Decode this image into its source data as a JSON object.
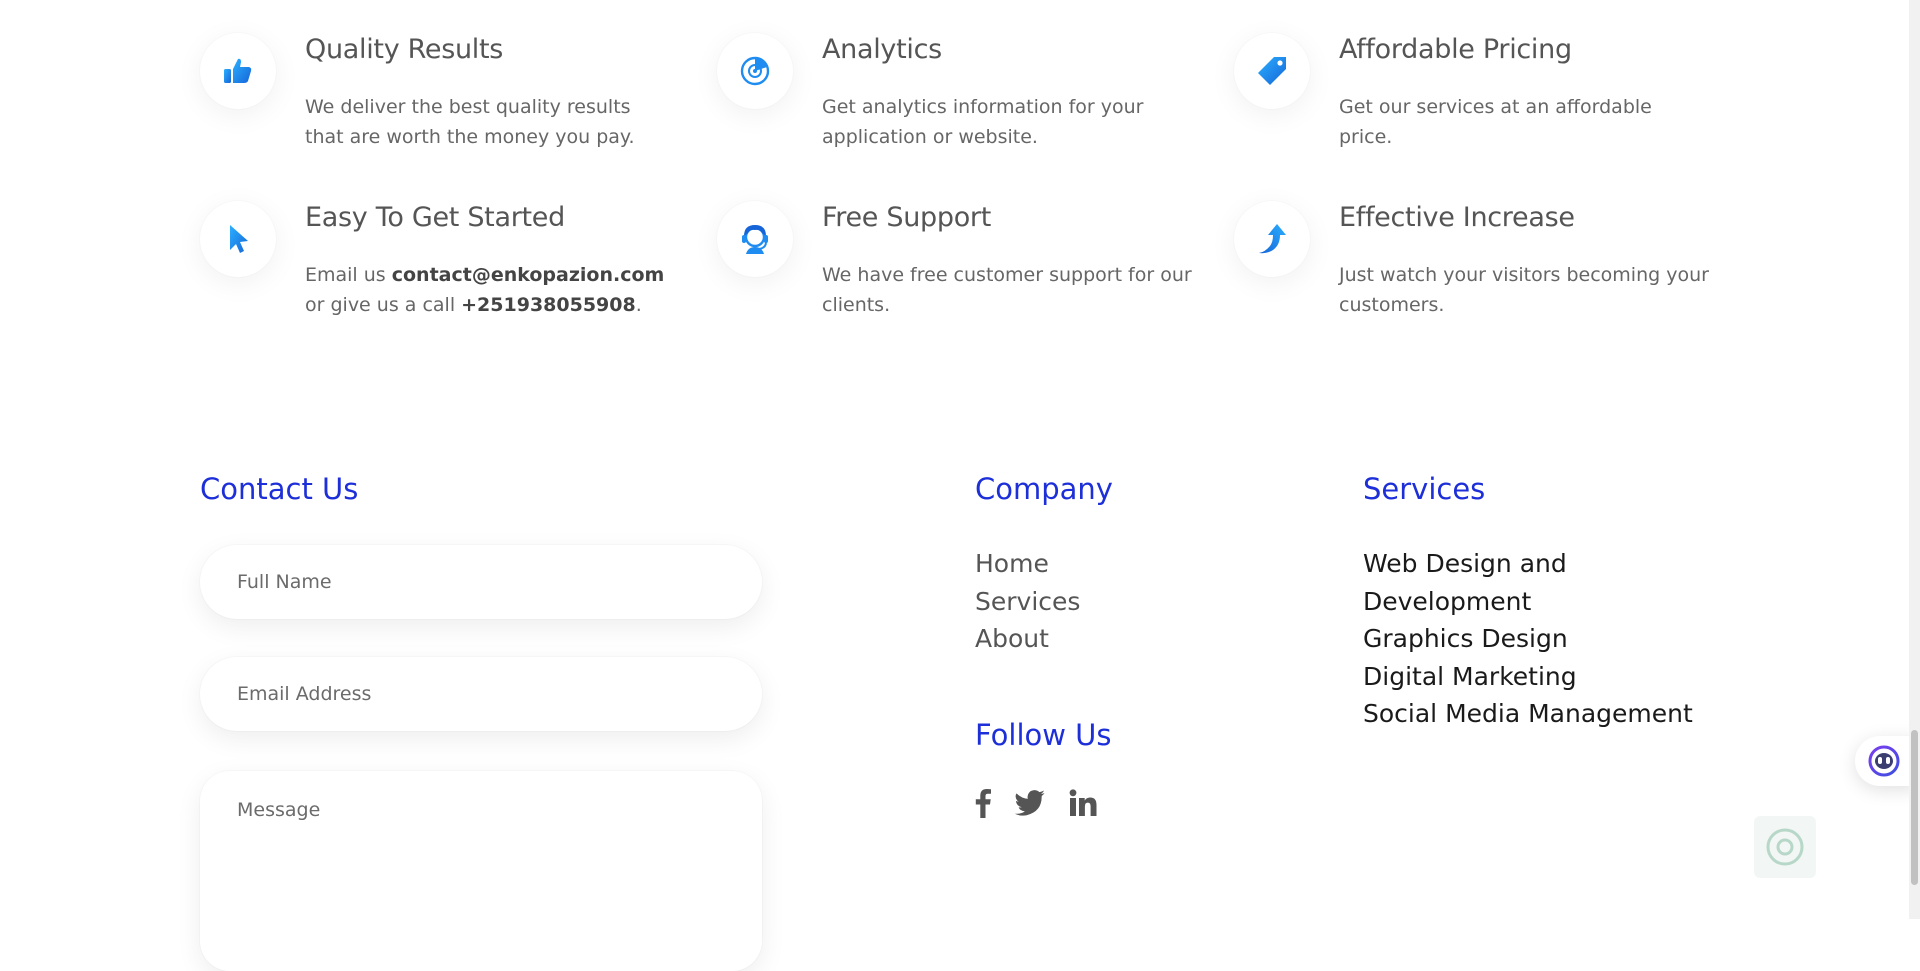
{
  "features": [
    {
      "icon": "thumbs-up-icon",
      "title": "Quality Results",
      "desc": "We deliver the best quality results that are worth the money you pay."
    },
    {
      "icon": "analytics-icon",
      "title": "Analytics",
      "desc": "Get analytics information for your application or website."
    },
    {
      "icon": "price-tag-icon",
      "title": "Affordable Pricing",
      "desc": "Get our services at an affordable price."
    },
    {
      "icon": "cursor-icon",
      "title": "Easy To Get Started",
      "desc_prefix": "Email us ",
      "email": "contact@enkopazion.com",
      "desc_middle": " or give us a call ",
      "phone": "+251938055908",
      "desc_suffix": "."
    },
    {
      "icon": "headset-support-icon",
      "title": "Free Support",
      "desc": "We have free customer support for our clients."
    },
    {
      "icon": "up-arrow-icon",
      "title": "Effective Increase",
      "desc": "Just watch your visitors becoming your customers."
    }
  ],
  "contact": {
    "title": "Contact Us",
    "name_placeholder": "Full Name",
    "email_placeholder": "Email Address",
    "message_placeholder": "Message"
  },
  "company": {
    "title": "Company",
    "links": [
      "Home",
      "Services",
      "About"
    ]
  },
  "follow": {
    "title": "Follow Us",
    "icons": [
      "facebook-icon",
      "twitter-icon",
      "linkedin-icon"
    ]
  },
  "services": {
    "title": "Services",
    "items": [
      "Web Design and",
      "Development",
      "Graphics Design",
      "Digital Marketing",
      "Social Media Management"
    ]
  },
  "colors": {
    "accent": "#1d2fd8",
    "icon_blue": "#1e8cf0",
    "text": "#555555"
  }
}
